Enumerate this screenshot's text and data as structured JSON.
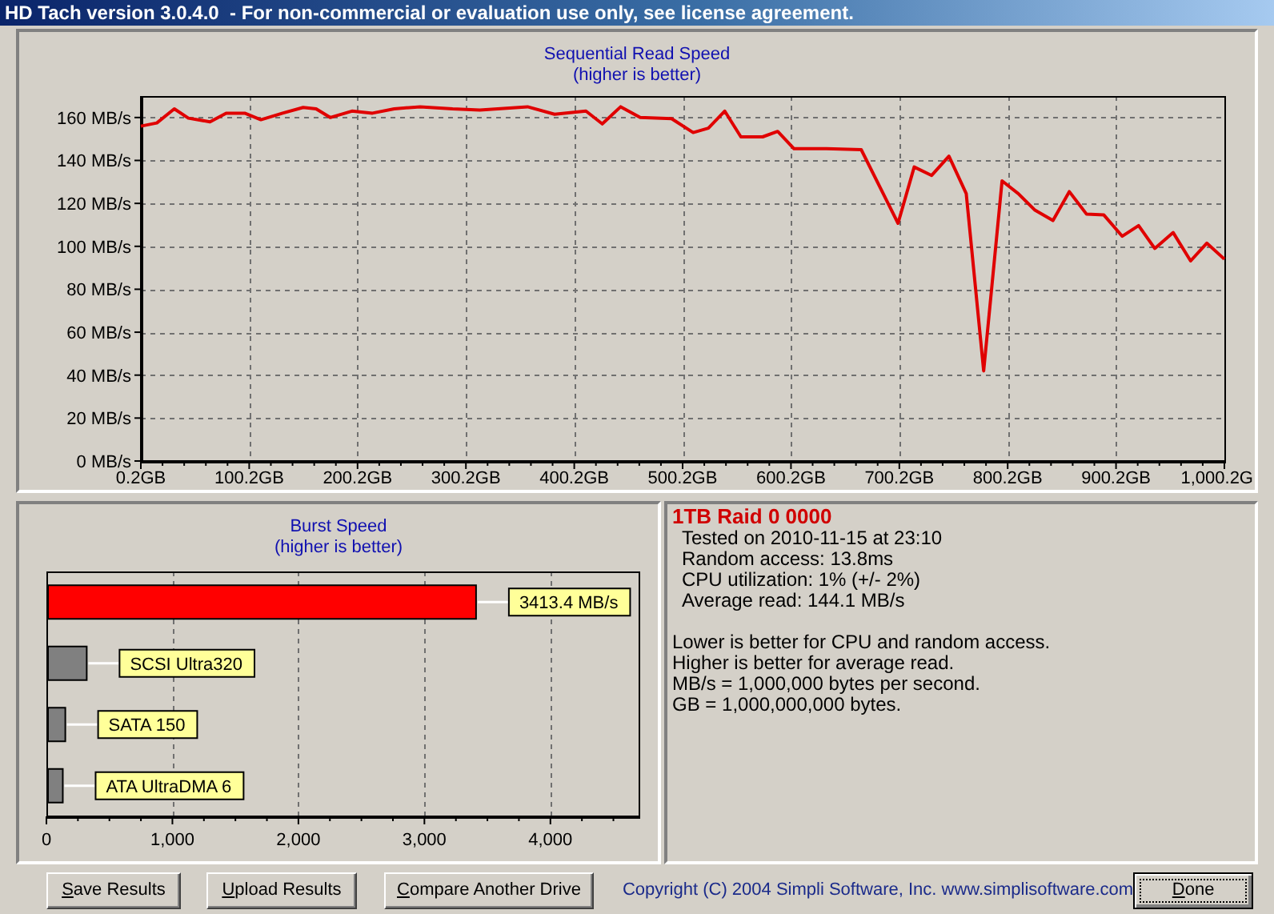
{
  "window": {
    "title": "HD Tach version 3.0.4.0  - For non-commercial or evaluation use only, see license agreement."
  },
  "read_chart": {
    "title": "Sequential Read Speed",
    "subtitle": "(higher is better)",
    "chart_data": {
      "type": "line",
      "x": [
        0.2,
        15,
        31,
        44,
        64,
        79,
        96,
        111,
        131,
        150,
        162,
        175,
        195,
        214,
        234,
        258,
        288,
        313,
        357,
        382,
        411,
        426,
        443,
        461,
        490,
        510,
        524,
        539,
        554,
        574,
        588,
        603,
        633,
        665,
        699,
        714,
        730,
        746,
        762,
        778,
        795,
        810,
        825,
        842,
        857,
        873,
        889,
        906,
        921,
        936,
        953,
        969,
        984,
        1000.2
      ],
      "series": [
        {
          "color": "#e00000",
          "values": [
            156,
            157.5,
            164,
            159.7,
            158,
            162,
            162,
            159,
            162,
            164.7,
            164,
            160,
            163,
            162,
            164,
            165,
            164,
            163.5,
            165,
            161.5,
            163,
            157,
            165,
            160,
            159.5,
            153,
            155,
            163,
            151,
            151,
            153.5,
            145.5,
            145.5,
            145,
            110.7,
            137,
            133,
            142,
            124.6,
            42,
            130.5,
            124.6,
            117,
            112,
            125.5,
            115,
            114.6,
            104.7,
            109.7,
            99,
            106.4,
            93.2,
            101.5,
            94
          ]
        }
      ],
      "xlim": [
        0.2,
        1000.2
      ],
      "ylim": [
        0,
        170
      ],
      "grid": true,
      "xticks": [
        {
          "value": 0.2,
          "label": "0.2GB"
        },
        {
          "value": 100.2,
          "label": "100.2GB"
        },
        {
          "value": 200.2,
          "label": "200.2GB"
        },
        {
          "value": 300.2,
          "label": "300.2GB"
        },
        {
          "value": 400.2,
          "label": "400.2GB"
        },
        {
          "value": 500.2,
          "label": "500.2GB"
        },
        {
          "value": 600.2,
          "label": "600.2GB"
        },
        {
          "value": 700.2,
          "label": "700.2GB"
        },
        {
          "value": 800.2,
          "label": "800.2GB"
        },
        {
          "value": 900.2,
          "label": "900.2GB"
        },
        {
          "value": 1000.2,
          "label": "1,000.2G"
        }
      ],
      "yticks": [
        {
          "value": 0,
          "label": "0 MB/s"
        },
        {
          "value": 20,
          "label": "20 MB/s"
        },
        {
          "value": 40,
          "label": "40 MB/s"
        },
        {
          "value": 60,
          "label": "60 MB/s"
        },
        {
          "value": 80,
          "label": "80 MB/s"
        },
        {
          "value": 100,
          "label": "100 MB/s"
        },
        {
          "value": 120,
          "label": "120 MB/s"
        },
        {
          "value": 140,
          "label": "140 MB/s"
        },
        {
          "value": 160,
          "label": "160 MB/s"
        }
      ]
    }
  },
  "burst_chart": {
    "title": "Burst Speed",
    "subtitle": "(higher is better)",
    "chart_data": {
      "type": "bar",
      "orientation": "horizontal",
      "categories": [
        "3413.4 MB/s",
        "SCSI Ultra320",
        "SATA 150",
        "ATA UltraDMA 6"
      ],
      "series": [
        {
          "color": "#ff0000",
          "values": [
            3410,
            null,
            null,
            null
          ]
        },
        {
          "color": "#808080",
          "values": [
            null,
            320,
            150,
            130
          ]
        }
      ],
      "xlim": [
        0,
        4700
      ],
      "grid": true,
      "xticks": [
        {
          "value": 0,
          "label": "0"
        },
        {
          "value": 1000,
          "label": "1,000"
        },
        {
          "value": 2000,
          "label": "2,000"
        },
        {
          "value": 3000,
          "label": "3,000"
        },
        {
          "value": 4000,
          "label": "4,000"
        }
      ]
    }
  },
  "results": {
    "drive_name": "1TB Raid 0 0000",
    "details": [
      "Tested on 2010-11-15 at 23:10",
      "Random access: 13.8ms",
      "CPU utilization: 1% (+/- 2%)",
      "Average read: 144.1 MB/s"
    ],
    "notes": [
      "Lower is better for CPU and random access.",
      "Higher is better for average read.",
      "MB/s = 1,000,000 bytes per second.",
      "GB = 1,000,000,000 bytes."
    ]
  },
  "buttons": [
    {
      "label": "Save Results",
      "default": false
    },
    {
      "label": "Upload Results",
      "default": false
    },
    {
      "label": "Compare Another Drive",
      "default": false
    }
  ],
  "copyright": "Copyright (C) 2004 Simpli Software, Inc. www.simplisoftware.com",
  "done_button": {
    "label": "Done",
    "default": true
  }
}
